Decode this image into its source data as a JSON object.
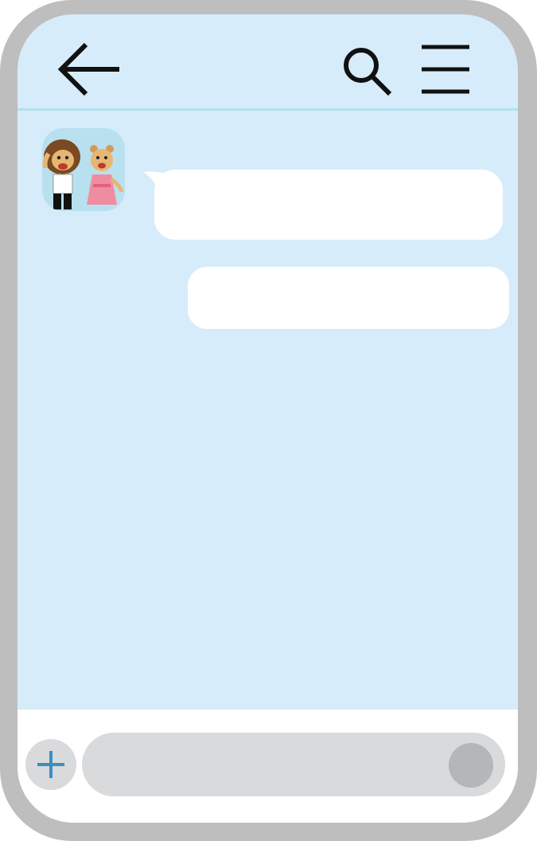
{
  "header": {
    "back_icon": "arrow-left-icon",
    "search_icon": "search-icon",
    "menu_icon": "hamburger-menu-icon"
  },
  "conversation": {
    "contact_avatar": "lion-couple-avatar",
    "messages": [
      {
        "direction": "incoming",
        "text": ""
      },
      {
        "direction": "outgoing",
        "text": ""
      }
    ]
  },
  "composer": {
    "add_icon": "plus-icon",
    "input_value": "",
    "input_placeholder": "",
    "send_icon": "send-circle-icon"
  },
  "colors": {
    "frame": "#bebebe",
    "screen_bg": "#d6ecfa",
    "header_divider": "#b3e0ee",
    "bubble": "#ffffff",
    "composer_bg": "#ffffff",
    "input_bg": "#d9dadc",
    "send_button": "#b5b6b8",
    "plus_icon": "#3a8fc0",
    "avatar_bg": "#b9e0ef"
  }
}
